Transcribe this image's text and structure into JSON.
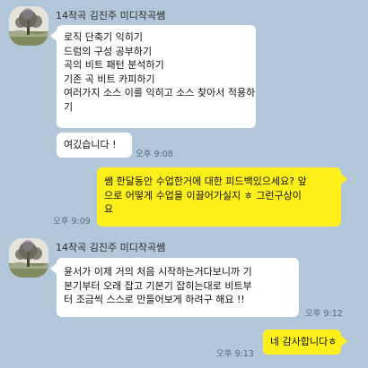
{
  "messages": [
    {
      "sender": "14작곡 김진주 미디작곡쌤",
      "avatar_icon": "tree-landscape-photo",
      "lines": [
        "로직 단축기 익히기",
        "드럼의 구성 공부하기",
        "곡의 비트 패턴 분석하기",
        "기존 곡 비트 카피하기",
        "여러가지 소스 이를 익히고 소스 찾아서 적용하",
        "기"
      ]
    },
    {
      "lines": [
        "여깄습니다 !"
      ],
      "time": "오후 9:08"
    },
    {
      "lines": [
        "쌤 한달동안 수업한거에 대한 피드백있으세요? 앞",
        "으로 어떻게 수업을 이끌어가실지 ㅎ 그런구상이",
        "요"
      ],
      "time": "오후 9:09"
    },
    {
      "sender": "14작곡 김진주 미디작곡쌤",
      "avatar_icon": "tree-landscape-photo",
      "lines": [
        "윤서가 이제 거의 처음 시작하는거다보니까 기",
        "본기부터 오래 잡고 기본기 잡히는대로 비트부",
        "터 조금씩 스스로 만들어보게 하려구 해요 !!"
      ],
      "time": "오후 9:12"
    },
    {
      "lines": [
        "네 감사합니다ㅎ"
      ],
      "time": "오후 9:13"
    }
  ],
  "colors": {
    "background": "#b2c7d9",
    "incoming_bubble": "#ffffff",
    "outgoing_bubble": "#fef01b"
  }
}
